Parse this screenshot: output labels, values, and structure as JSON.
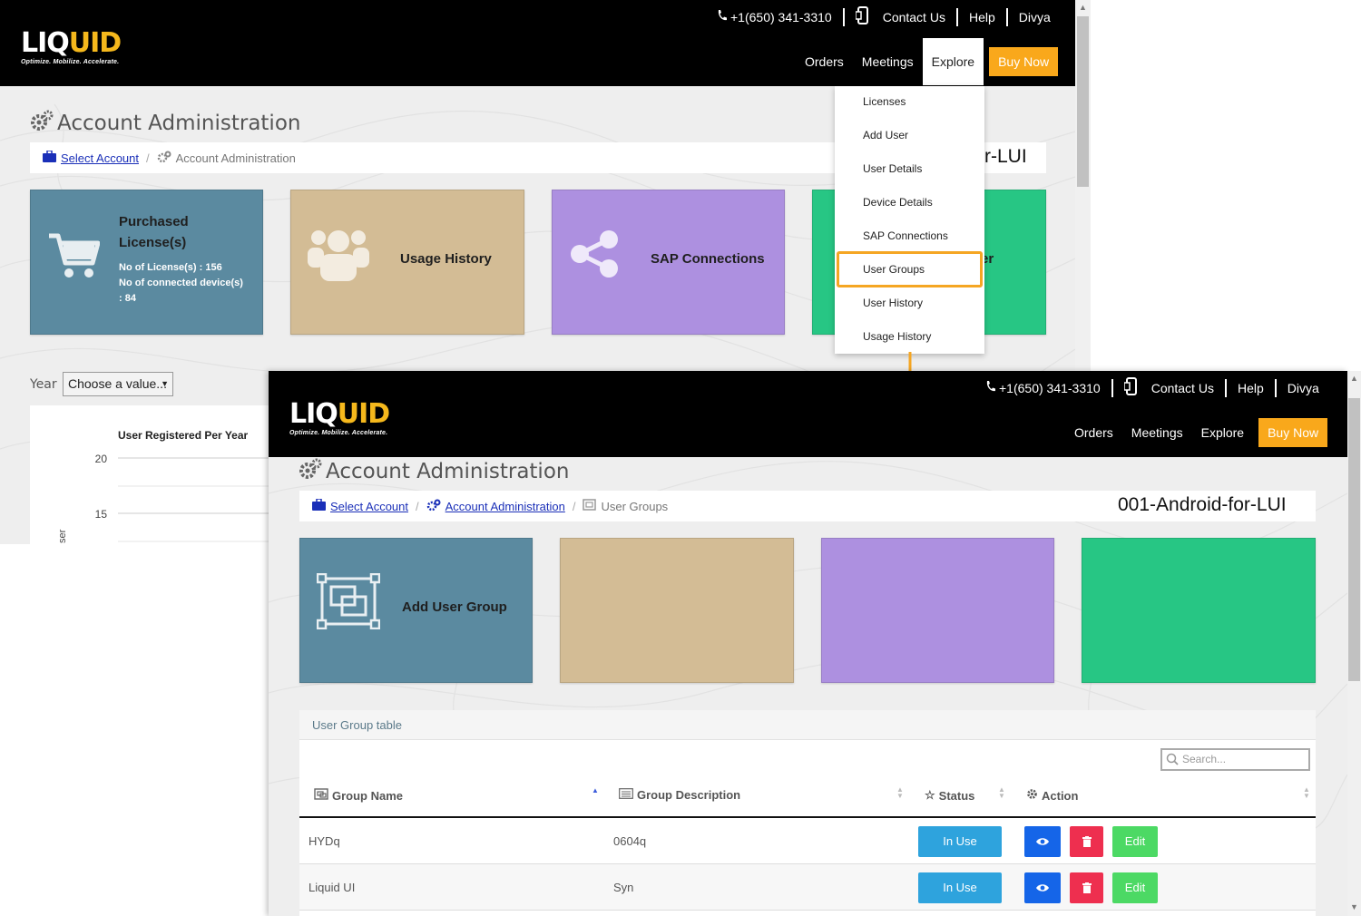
{
  "header": {
    "phone": "+1(650) 341-3310",
    "contact": "Contact Us",
    "help": "Help",
    "user": "Divya",
    "logo_main": "LIQ",
    "logo_accent": "UID",
    "logo_tagline": "Optimize. Mobilize. Accelerate.",
    "nav": {
      "orders": "Orders",
      "meetings": "Meetings",
      "explore": "Explore",
      "buy": "Buy Now"
    },
    "accent_color": "#f9a81b"
  },
  "background_page": {
    "title": "Account Administration",
    "breadcrumb": {
      "select_account": "Select Account",
      "current": "Account Administration"
    },
    "account_name_partial": "r-LUI",
    "tiles": {
      "purchased_title_1": "Purchased",
      "purchased_title_2": "License(s)",
      "licenses_line": "No of License(s) : 156",
      "devices_line_1": "No of connected device(s)",
      "devices_line_2": ": 84",
      "usage": "Usage History",
      "sap": "SAP Connections",
      "green_partial": "er"
    },
    "year_label": "Year",
    "year_select": "Choose a value...",
    "chart_data": {
      "type": "line",
      "title": "User Registered Per Year",
      "ylabel_partial": "ser",
      "yticks": [
        20,
        15
      ],
      "series": []
    }
  },
  "explore_menu": {
    "items": [
      "Licenses",
      "Add User",
      "User Details",
      "Device Details",
      "SAP Connections",
      "User Groups",
      "User History",
      "Usage History"
    ],
    "highlighted": "User Groups",
    "highlight_color": "#f5a623"
  },
  "overlay_page": {
    "title": "Account Administration",
    "breadcrumb": {
      "select_account": "Select Account",
      "account_admin": "Account Administration",
      "current": "User Groups"
    },
    "account_name": "001-Android-for-LUI",
    "add_group_tile": "Add User Group",
    "table": {
      "title": "User Group table",
      "search_placeholder": "Search...",
      "columns": [
        "Group Name",
        "Group Description",
        "Status",
        "Action"
      ],
      "rows": [
        {
          "name": "HYDq",
          "description": "0604q",
          "status": "In Use",
          "edit": "Edit"
        },
        {
          "name": "Liquid UI",
          "description": "Syn",
          "status": "In Use",
          "edit": "Edit"
        }
      ]
    }
  }
}
